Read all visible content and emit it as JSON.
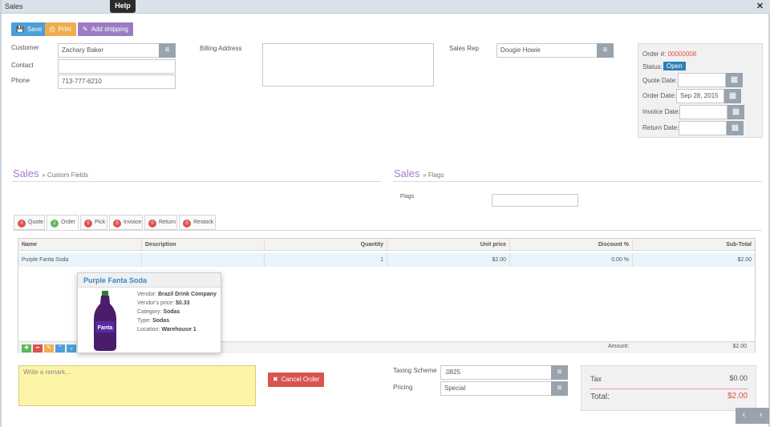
{
  "window": {
    "title": "Sales",
    "help_tooltip": "Help"
  },
  "toolbar": {
    "save": "Save",
    "print": "Print",
    "add_shipping": "Add shipping"
  },
  "customer": {
    "customer_label": "Customer",
    "customer_value": "Zachary Baker",
    "contact_label": "Contact",
    "contact_value": "",
    "phone_label": "Phone",
    "phone_value": "713-777-6210",
    "billing_label": "Billing Address",
    "billing_value": "",
    "sales_rep_label": "Sales Rep",
    "sales_rep_value": "Dougie Howie"
  },
  "order_panel": {
    "order_no_label": "Order #:",
    "order_no": "00000008",
    "status_label": "Status:",
    "status": "Open",
    "quote_date_label": "Quote Date:",
    "quote_date": "",
    "order_date_label": "Order Date:",
    "order_date": "Sep 28, 2015",
    "invoice_date_label": "Invoice Date:",
    "invoice_date": "",
    "return_date_label": "Return Date:",
    "return_date": ""
  },
  "sections": {
    "custom_title": "Sales",
    "custom_sub": "» Custom Fields",
    "flags_title": "Sales",
    "flags_sub": "» Flags",
    "flags_label": "Flags",
    "flags_value": ""
  },
  "tabs": [
    {
      "count": "0",
      "label": "Quote",
      "color": "#d9534f"
    },
    {
      "count": "1",
      "label": "Order",
      "color": "#5cb85c"
    },
    {
      "count": "0",
      "label": "Pick",
      "color": "#d9534f"
    },
    {
      "count": "0",
      "label": "Invoice",
      "color": "#d9534f"
    },
    {
      "count": "0",
      "label": "Return",
      "color": "#d9534f"
    },
    {
      "count": "0",
      "label": "Restock",
      "color": "#d9534f"
    }
  ],
  "grid": {
    "columns": [
      "Name",
      "Description",
      "Quantity",
      "Unit price",
      "Discount %",
      "Sub-Total"
    ],
    "row": [
      "Purple Fanta Soda",
      "",
      "1",
      "$2.00",
      "0.00 %",
      "$2.00"
    ],
    "amount_label": "Amount:",
    "amount_value": "$2.00"
  },
  "popup": {
    "title": "Purple Fanta Soda",
    "vendor_label": "Vendor:",
    "vendor": "Brazil Drink Company",
    "vprice_label": "Vendor's price:",
    "vprice": "$0.33",
    "category_label": "Category:",
    "category": "Sodas",
    "type_label": "Type:",
    "type": "Sodas",
    "location_label": "Location:",
    "location": "Warehouse 1",
    "image_text": "Fanta"
  },
  "footer": {
    "remark_placeholder": "Write a remark...",
    "cancel_order": "Cancel Order",
    "taxing_label": "Taxing Scheme",
    "taxing_value": ".0825",
    "pricing_label": "Pricing",
    "pricing_value": "Special",
    "tax_label": "Tax",
    "tax_value": "$0.00",
    "total_label": "Total:",
    "total_value": "$2.00"
  },
  "colors": {
    "save": "#4d9fd9",
    "print": "#f0ad4e",
    "shipping": "#9b7cc4",
    "accent_purple": "#a57bd0",
    "order_red": "#e74c3c",
    "status_blue": "#2d7fb8"
  }
}
